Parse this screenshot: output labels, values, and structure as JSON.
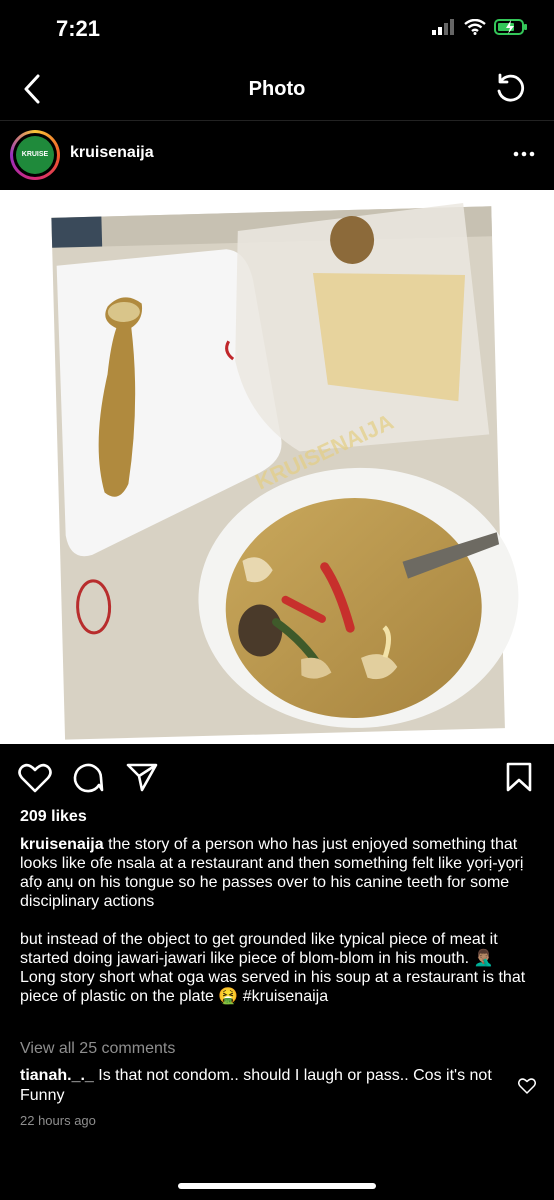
{
  "status": {
    "time": "7:21"
  },
  "nav": {
    "title": "Photo"
  },
  "post": {
    "username": "kruisenaija",
    "avatar_text": "KRUISE",
    "watermark": "KRUISENAIJA",
    "likes": "209 likes",
    "caption_user": "kruisenaija",
    "caption_p1": "the story of a person who has just enjoyed something that looks like ofe nsala at a restaurant and then something felt like yọrị-yọrị afọ anụ on his tongue so he passes over to his canine teeth for some disciplinary actions",
    "caption_p2": "but instead of the object to get grounded like typical piece of meat it started doing jawari-jawari like piece of blom-blom in his mouth. 🤦🏽‍♂️",
    "caption_p3": "Long story short what oga was served in his soup at a restaurant is that piece of plastic on the plate 🤮  #kruisenaija",
    "view_comments": "View all 25 comments",
    "comment_user": "tianah._._",
    "comment_text": "Is that not condom.. should I laugh or pass.. Cos it's not Funny",
    "timestamp": "22 hours ago"
  },
  "colors": {
    "muted": "#8e8e8e",
    "accent_green": "#1f8a3b"
  }
}
